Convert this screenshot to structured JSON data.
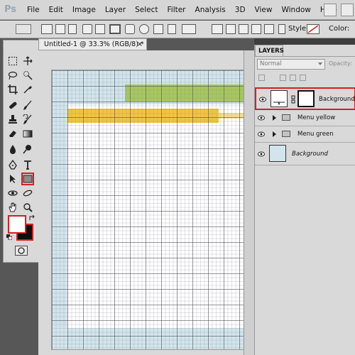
{
  "app": {
    "logo": "Ps"
  },
  "menu": {
    "items": [
      "File",
      "Edit",
      "Image",
      "Layer",
      "Select",
      "Filter",
      "Analysis",
      "3D",
      "View",
      "Window",
      "Help"
    ]
  },
  "options_bar": {
    "style_label": "Style:",
    "color_label": "Color:"
  },
  "document": {
    "tab_title": "Untitled-1 @ 33.3% (RGB/8) *",
    "close_label": "×"
  },
  "layers_panel": {
    "tab_label": "LAYERS",
    "blend_mode": "Normal",
    "opacity_label": "Opacity:",
    "layers": [
      {
        "name": "Background",
        "type": "shape",
        "selected": true
      },
      {
        "name": "Menu yellow",
        "type": "group"
      },
      {
        "name": "Menu green",
        "type": "group"
      },
      {
        "name": "Background",
        "type": "locked-background"
      }
    ]
  },
  "colors": {
    "highlight": "#d81e1e",
    "foreground": "#ffffff",
    "background": "#0e0e0e",
    "canvas_blue": "#d2e5ec",
    "menu_green": "#a7c85c",
    "menu_yellow": "#f2c53f"
  },
  "icons": {
    "toolbox": [
      "move-icon",
      "marquee-icon",
      "lasso-icon",
      "quick-select-icon",
      "crop-icon",
      "eyedropper-icon",
      "healing-brush-icon",
      "brush-icon",
      "stamp-icon",
      "history-brush-icon",
      "eraser-icon",
      "gradient-icon",
      "blur-icon",
      "dodge-icon",
      "pen-icon",
      "type-icon",
      "path-select-icon",
      "rectangle-shape-icon",
      "3d-rotate-icon",
      "3d-orbit-icon",
      "hand-icon",
      "zoom-icon"
    ]
  }
}
